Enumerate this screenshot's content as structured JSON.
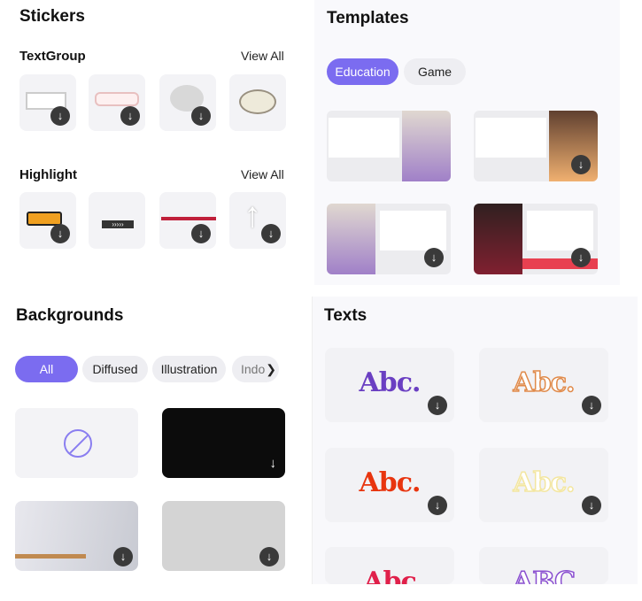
{
  "stickers": {
    "title": "Stickers",
    "groups": [
      {
        "title": "TextGroup",
        "view_all": "View All",
        "items": [
          "white-box",
          "pink-speech-bubble",
          "thought-cloud",
          "oval-speech-bubble"
        ]
      },
      {
        "title": "Highlight",
        "view_all": "View All",
        "items": [
          "orange-arrow",
          "chevron-strip",
          "red-underline",
          "white-up-arrow"
        ]
      }
    ]
  },
  "templates": {
    "title": "Templates",
    "tabs": [
      {
        "label": "Education",
        "active": true
      },
      {
        "label": "Game",
        "active": false
      }
    ],
    "cards": [
      "template-1",
      "template-2",
      "template-3",
      "template-4"
    ]
  },
  "backgrounds": {
    "title": "Backgrounds",
    "tabs": [
      {
        "label": "All",
        "active": true
      },
      {
        "label": "Diffused"
      },
      {
        "label": "Illustration"
      },
      {
        "label": "Indo"
      }
    ],
    "items": [
      "none",
      "black-texture",
      "room-with-bench",
      "gray"
    ]
  },
  "texts": {
    "title": "Texts",
    "samples": [
      {
        "label": "Abc.",
        "color": "#6a3fc2"
      },
      {
        "label": "Abc.",
        "color": "#e08a4a"
      },
      {
        "label": "Abc.",
        "color": "#e8350f"
      },
      {
        "label": "Abc.",
        "color": "#f3e6a0"
      },
      {
        "label": "Abc",
        "color": "#e0204a"
      },
      {
        "label": "ABC",
        "color": "#8a4fd0"
      }
    ]
  },
  "colors": {
    "accent": "#7b6cf0"
  }
}
